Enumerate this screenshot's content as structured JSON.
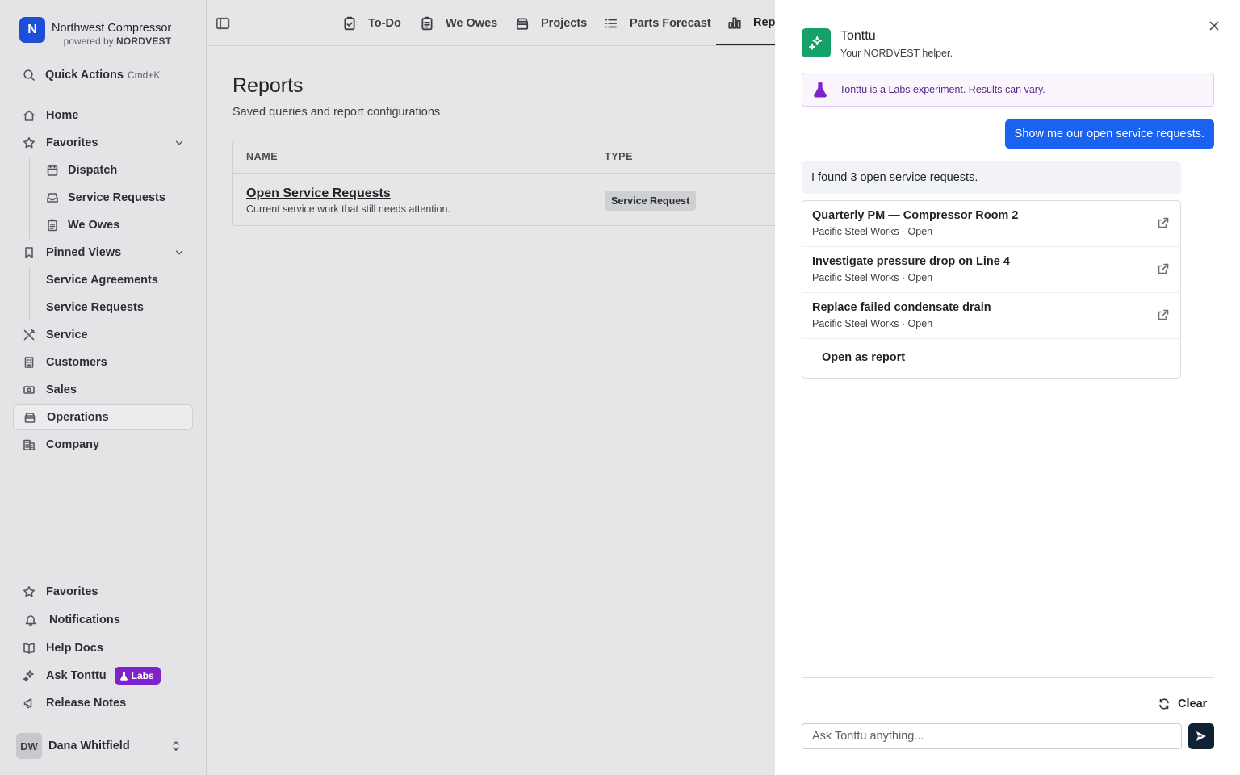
{
  "brand": {
    "logo_letter": "N",
    "name": "Northwest Compressor",
    "powered_prefix": "powered by",
    "powered_brand": "NORDVEST",
    "logo_color": "#1d4ed8"
  },
  "quick_actions": {
    "label": "Quick Actions",
    "shortcut": "Cmd+K",
    "icon": "search-icon"
  },
  "nav": {
    "home": "Home",
    "favorites": {
      "label": "Favorites",
      "items": [
        "Dispatch",
        "Service Requests",
        "We Owes"
      ]
    },
    "pinned": {
      "label": "Pinned Views",
      "items": [
        "Service Agreements",
        "Service Requests"
      ]
    },
    "service": "Service",
    "customers": "Customers",
    "sales": "Sales",
    "operations": "Operations",
    "company": "Company"
  },
  "footer_nav": {
    "favorites": "Favorites",
    "notifications": "Notifications",
    "help": "Help Docs",
    "ask": "Ask Tonttu",
    "labs": "Labs",
    "release": "Release Notes"
  },
  "user": {
    "initials": "DW",
    "name": "Dana Whitfield"
  },
  "tabs": [
    {
      "label": "To-Do",
      "icon": "clipboard-check-icon"
    },
    {
      "label": "We Owes",
      "icon": "clipboard-list-icon"
    },
    {
      "label": "Projects",
      "icon": "archive-box-icon"
    },
    {
      "label": "Parts Forecast",
      "icon": "list-icon"
    },
    {
      "label": "Reports",
      "icon": "bar-chart-icon",
      "active": true
    }
  ],
  "page": {
    "title": "Reports",
    "subtitle": "Saved queries and report configurations",
    "columns": [
      "NAME",
      "TYPE"
    ],
    "rows": [
      {
        "name": "Open Service Requests",
        "description": "Current service work that still needs attention.",
        "type": "Service Request"
      }
    ]
  },
  "assistant": {
    "name": "Tonttu",
    "tagline": "Your NORDVEST helper.",
    "labs_note": "Tonttu is a Labs experiment. Results can vary.",
    "user_message": "Show me our open service requests.",
    "bot_message": "I found 3 open service requests.",
    "results": [
      {
        "title": "Quarterly PM — Compressor Room 2",
        "meta": "Pacific Steel Works · Open"
      },
      {
        "title": "Investigate pressure drop on Line 4",
        "meta": "Pacific Steel Works · Open"
      },
      {
        "title": "Replace failed condensate drain",
        "meta": "Pacific Steel Works · Open"
      }
    ],
    "open_report": "Open as report",
    "clear": "Clear",
    "input_placeholder": "Ask Tonttu anything...",
    "input_value": "",
    "accent": "#1a62f0",
    "bot_color": "#15a167",
    "labs_color": "#7e22ce"
  }
}
